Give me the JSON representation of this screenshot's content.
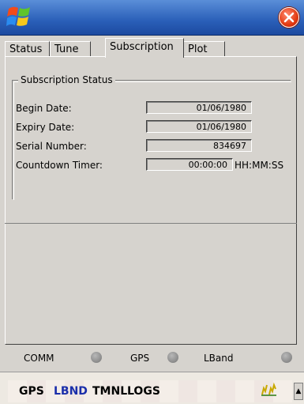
{
  "window": {
    "logo_icon": "windows-flag-icon",
    "close_icon": "close-icon",
    "close_color": "#e23a12",
    "titlebar_color": "#2a5fb8"
  },
  "tabs": [
    {
      "label": "Status",
      "active": false
    },
    {
      "label": "Tune",
      "active": false
    },
    {
      "label": "Subscription",
      "active": true
    },
    {
      "label": "Plot",
      "active": false
    }
  ],
  "subscription": {
    "group_title": "Subscription Status",
    "fields": [
      {
        "label": "Begin Date:",
        "value": "01/06/1980",
        "unit": ""
      },
      {
        "label": "Expiry Date:",
        "value": "01/06/1980",
        "unit": ""
      },
      {
        "label": "Serial Number:",
        "value": "834697",
        "unit": ""
      },
      {
        "label": "Countdown Timer:",
        "value": "00:00:00",
        "unit": "HH:MM:SS"
      }
    ]
  },
  "indicators": [
    {
      "label": "COMM",
      "state": "off"
    },
    {
      "label": "GPS",
      "state": "off"
    },
    {
      "label": "LBand",
      "state": "off"
    }
  ],
  "taskbar": {
    "items": [
      {
        "label": "GPS",
        "color": "#000000"
      },
      {
        "label": "LBND",
        "color": "#1a2eaa"
      },
      {
        "label": "TMNL",
        "color": "#000000"
      },
      {
        "label": "LOGS",
        "color": "#000000"
      }
    ],
    "signal_icon": "signal-antenna-icon",
    "scroll_icon": "scroll-up-arrow-icon"
  }
}
